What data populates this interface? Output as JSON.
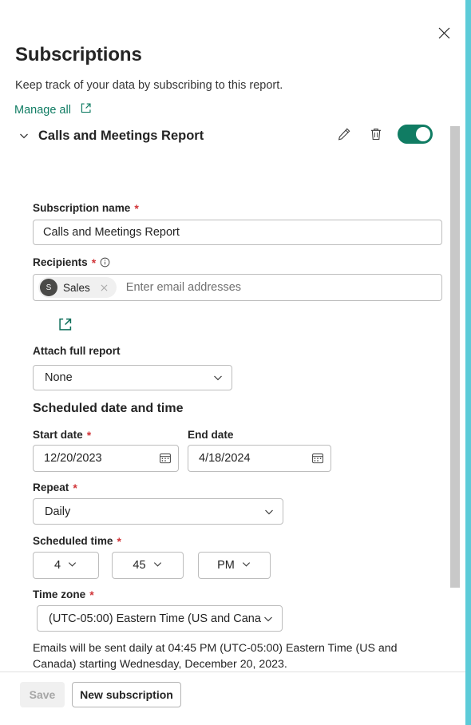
{
  "panel": {
    "title": "Subscriptions",
    "subtitle": "Keep track of your data by subscribing to this report.",
    "manage_all_label": "Manage all",
    "close_icon": "close-icon",
    "accent_color": "#5ccbd8",
    "link_color": "#107c63"
  },
  "subscription": {
    "name": "Calls and Meetings Report",
    "collapse_icon": "chevron-down-icon",
    "edit_icon": "pencil-icon",
    "delete_icon": "trash-icon",
    "toggle_state": "on",
    "toggle_color": "#107c63"
  },
  "form": {
    "subscription_name": {
      "label": "Subscription name",
      "required": "*",
      "value": "Calls and Meetings Report"
    },
    "recipients": {
      "label": "Recipients",
      "required": "*",
      "info_icon": "info-icon",
      "placeholder": "Enter email addresses",
      "chips": [
        {
          "initial": "S",
          "name": "Sales",
          "remove_icon": "close-icon"
        }
      ],
      "open_picker_icon": "external-link-icon"
    },
    "attach_full_report": {
      "label": "Attach full report",
      "value": "None",
      "chevron_icon": "chevron-down-icon"
    },
    "scheduled_section_title": "Scheduled date and time",
    "start_date": {
      "label": "Start date",
      "required": "*",
      "value": "12/20/2023",
      "calendar_icon": "calendar-icon"
    },
    "end_date": {
      "label": "End date",
      "required": "",
      "value": "4/18/2024",
      "calendar_icon": "calendar-icon"
    },
    "repeat": {
      "label": "Repeat",
      "required": "*",
      "value": "Daily",
      "chevron_icon": "chevron-down-icon"
    },
    "scheduled_time": {
      "label": "Scheduled time",
      "required": "*",
      "hour": "4",
      "minute": "45",
      "meridiem": "PM",
      "chevron_icon": "chevron-down-icon"
    },
    "time_zone": {
      "label": "Time zone",
      "required": "*",
      "value": "(UTC-05:00) Eastern Time (US and Cana",
      "chevron_icon": "chevron-down-icon"
    },
    "summary_text": "Emails will be sent daily at 04:45 PM (UTC-05:00) Eastern Time (US and Canada) starting Wednesday, December 20, 2023."
  },
  "footer": {
    "save_label": "Save",
    "new_subscription_label": "New subscription"
  }
}
